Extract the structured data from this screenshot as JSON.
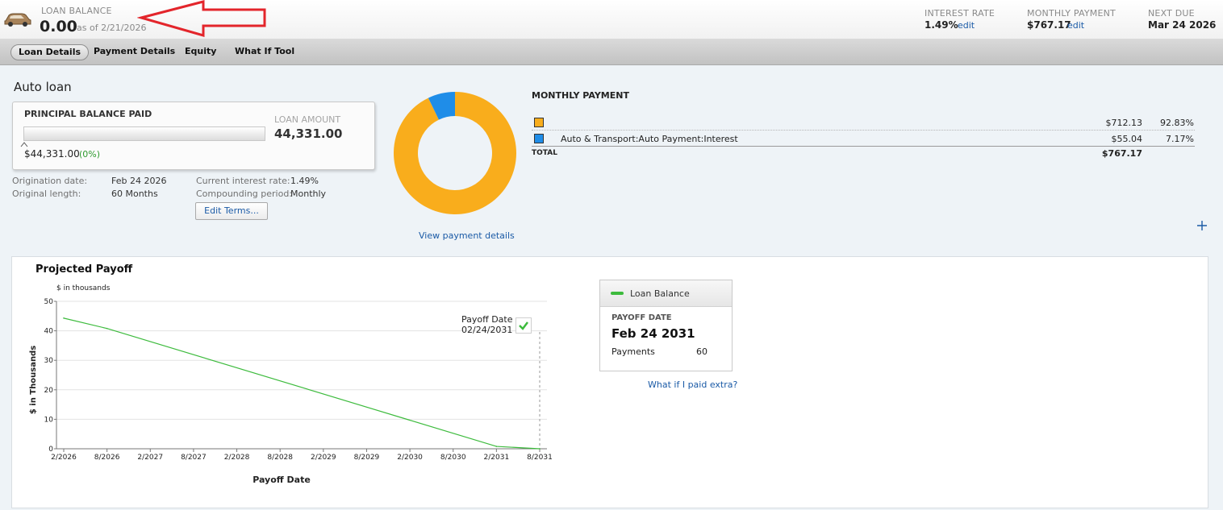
{
  "header": {
    "balance_label": "LOAN BALANCE",
    "balance_value": "0.00",
    "balance_asof": "as of 2/21/2026",
    "interest_rate_label": "INTEREST RATE",
    "interest_rate_value": "1.49%",
    "monthly_payment_label": "MONTHLY PAYMENT",
    "monthly_payment_value": "$767.17",
    "edit_label": "edit",
    "next_due_label": "NEXT DUE",
    "next_due_value": "Mar 24 2026"
  },
  "tabs": [
    {
      "label": "Loan Details",
      "active": true
    },
    {
      "label": "Payment Details",
      "active": false
    },
    {
      "label": "Equity",
      "active": false
    },
    {
      "label": "What If Tool",
      "active": false
    }
  ],
  "loan": {
    "title": "Auto loan",
    "principal_label": "PRINCIPAL BALANCE PAID",
    "principal_paid_value": "$44,331.00",
    "principal_paid_pct": "(0%)",
    "principal_progress_fraction": 0,
    "loan_amount_label": "LOAN AMOUNT",
    "loan_amount_value": "44,331.00",
    "origination_label": "Origination date:",
    "origination_value": "Feb 24 2026",
    "length_label": "Original length:",
    "length_value": "60 Months",
    "rate_label": "Current interest rate:",
    "rate_value": "1.49%",
    "compounding_label": "Compounding period:",
    "compounding_value": "Monthly",
    "edit_terms_label": "Edit Terms..."
  },
  "payment_breakdown": {
    "title": "MONTHLY PAYMENT",
    "rows": [
      {
        "label": "",
        "amount": "$712.13",
        "pct": "92.83%",
        "color": "#f9ad1c"
      },
      {
        "label": "Auto & Transport:Auto Payment:Interest",
        "amount": "$55.04",
        "pct": "7.17%",
        "color": "#1f8de8"
      }
    ],
    "total_label": "TOTAL",
    "total_amount": "$767.17",
    "view_details_label": "View payment details",
    "donut_fractions": [
      0.9283,
      0.0717
    ]
  },
  "add_icon": "plus-icon",
  "projection": {
    "title": "Projected Payoff",
    "units_note": "$ in thousands",
    "payoff_marker_label": "Payoff Date",
    "payoff_marker_date": "02/24/2031",
    "legend_label": "Loan Balance",
    "payoff_date_label": "PAYOFF DATE",
    "payoff_date_value": "Feb 24 2031",
    "payments_label": "Payments",
    "payments_value": "60",
    "what_if_label": "What if I paid extra?"
  },
  "chart_data": {
    "type": "line",
    "xlabel": "Payoff Date",
    "ylabel": "$ in Thousands",
    "ylim": [
      0,
      50
    ],
    "yticks": [
      0,
      10,
      20,
      30,
      40,
      50
    ],
    "xticks": [
      "2/2026",
      "8/2026",
      "2/2027",
      "8/2027",
      "2/2028",
      "8/2028",
      "2/2029",
      "8/2029",
      "2/2030",
      "8/2030",
      "2/2031",
      "8/2031"
    ],
    "grid": true,
    "series": [
      {
        "name": "Loan Balance",
        "color": "#3dbb3d",
        "x": [
          "2/2026",
          "8/2026",
          "2/2031",
          "8/2031"
        ],
        "values": [
          44.3,
          40.8,
          0.8,
          0
        ]
      }
    ]
  }
}
